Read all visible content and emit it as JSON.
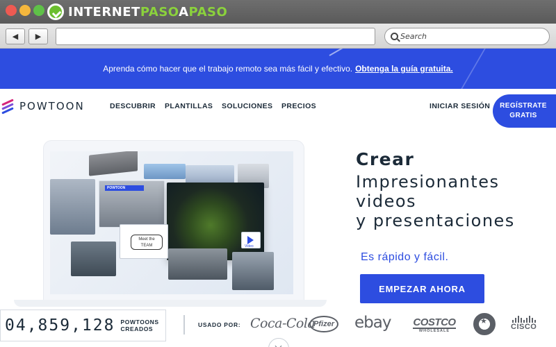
{
  "chrome": {
    "site_brand_part1": "INTERNET",
    "site_brand_part2": "PASO",
    "site_brand_part3": "A",
    "site_brand_part4": "PASO",
    "back_glyph": "◀",
    "forward_glyph": "▶",
    "url": "",
    "search_placeholder": "Search",
    "icons": [
      "back-arrow-icon",
      "forward-arrow-icon",
      "search-icon"
    ],
    "brand_colors": {
      "green": "#8bd23c",
      "white": "#ffffff"
    }
  },
  "banner": {
    "text": "Aprenda cómo hacer que el trabajo remoto sea más fácil y efectivo.",
    "link": "Obtenga la guía gratuita.",
    "background": "#2d4de0"
  },
  "nav": {
    "logo": "POWTOON",
    "links": [
      "DESCUBRIR",
      "PLANTILLAS",
      "SOLUCIONES",
      "PRECIOS"
    ],
    "login": "INICIAR SESIÓN",
    "signup_line1": "REGÍSTRATE",
    "signup_line2": "GRATIS"
  },
  "hero": {
    "illustration_tag": "POWTOON",
    "meet_line1": "Meet the",
    "meet_line2": "TEAM",
    "video_label": "Video",
    "title": "Crear",
    "lines": [
      "Impresionantes",
      "videos",
      "y presentaciones"
    ],
    "subtitle": "Es rápido y fácil.",
    "cta": "EMPEZAR AHORA",
    "accent": "#2d4de0"
  },
  "stats": {
    "count": "04,859,128",
    "label_line1": "POWTOONS",
    "label_line2": "CREADOS"
  },
  "clients": {
    "label": "USADO POR:",
    "logos": {
      "coca_cola": "Coca-Cola",
      "pfizer": "Pfizer",
      "ebay": "ebay",
      "costco": "COSTCO",
      "costco_sub": "WHOLESALE",
      "starbucks": "starbucks-logo",
      "cisco": "CISCO"
    }
  }
}
